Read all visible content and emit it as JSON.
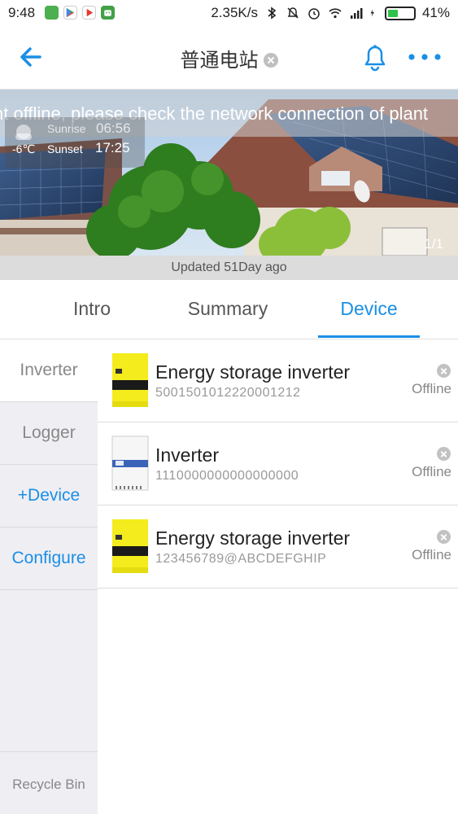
{
  "status_bar": {
    "time": "9:48",
    "speed": "2.35K/s",
    "battery": "41%",
    "battery_fraction": 0.41
  },
  "nav": {
    "title": "普通电站"
  },
  "banner": {
    "ticker": "nt offline, please check the network connection of plant",
    "sunrise_label": "Sunrise",
    "sunrise_time": "06:56",
    "temperature": "-6℃",
    "sunset_label": "Sunset",
    "sunset_time": "17:25",
    "pager": "1/1",
    "updated": "Updated 51Day ago"
  },
  "tabs": [
    {
      "label": "Intro"
    },
    {
      "label": "Summary"
    },
    {
      "label": "Device"
    }
  ],
  "sidebar": {
    "items": [
      {
        "label": "Inverter"
      },
      {
        "label": "Logger"
      },
      {
        "label": "+Device"
      },
      {
        "label": "Configure"
      }
    ],
    "recycle": "Recycle Bin"
  },
  "devices": [
    {
      "name": "Energy storage inverter",
      "sn": "5001501012220001212",
      "status": "Offline",
      "thumb": "yellow-inverter"
    },
    {
      "name": "Inverter",
      "sn": "1110000000000000000",
      "status": "Offline",
      "thumb": "white-inverter"
    },
    {
      "name": "Energy storage inverter",
      "sn": "123456789@ABCDEFGHIP",
      "status": "Offline",
      "thumb": "yellow-inverter"
    }
  ],
  "colors": {
    "accent": "#1a8fe6",
    "sidebar_bg": "#efeef3",
    "battery": "#2ec24a"
  }
}
